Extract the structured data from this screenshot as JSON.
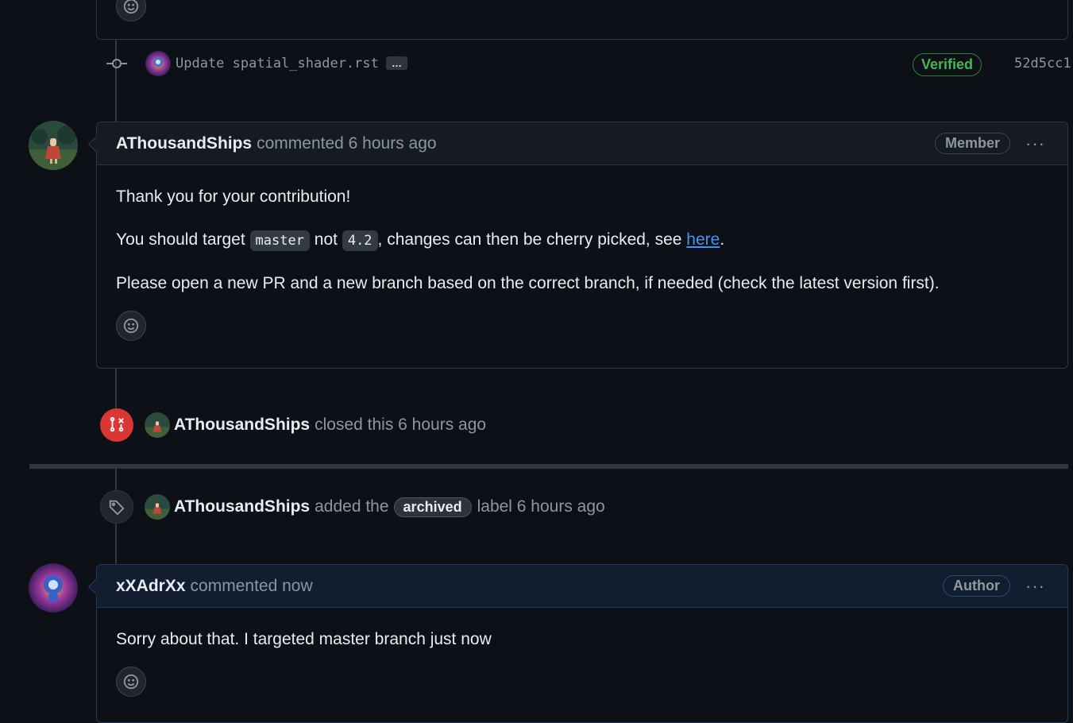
{
  "commit": {
    "message": "Update spatial_shader.rst",
    "ellipsis": "…",
    "verified_label": "Verified",
    "sha": "52d5cc1"
  },
  "comment1": {
    "author": "AThousandShips",
    "action": "commented 6 hours ago",
    "role": "Member",
    "kebab": "···",
    "line1": "Thank you for your contribution!",
    "line2_pre": "You should target ",
    "code1": "master",
    "line2_mid1": " not ",
    "code2": "4.2",
    "line2_mid2": ", changes can then be cherry picked, see ",
    "link_text": "here",
    "line2_post": ".",
    "line3": "Please open a new PR and a new branch based on the correct branch, if needed (check the latest version first)."
  },
  "closed_event": {
    "author": "AThousandShips",
    "text": "closed this 6 hours ago"
  },
  "label_event": {
    "author": "AThousandShips",
    "pre": "added the",
    "label": "archived",
    "post": "label 6 hours ago"
  },
  "comment2": {
    "author": "xXAdrXx",
    "action": "commented now",
    "role": "Author",
    "kebab": "···",
    "body": "Sorry about that. I targeted master branch just now"
  },
  "colors": {
    "closed_icon_bg": "#da3633",
    "link": "#4493f8",
    "verified": "#3fb950"
  }
}
